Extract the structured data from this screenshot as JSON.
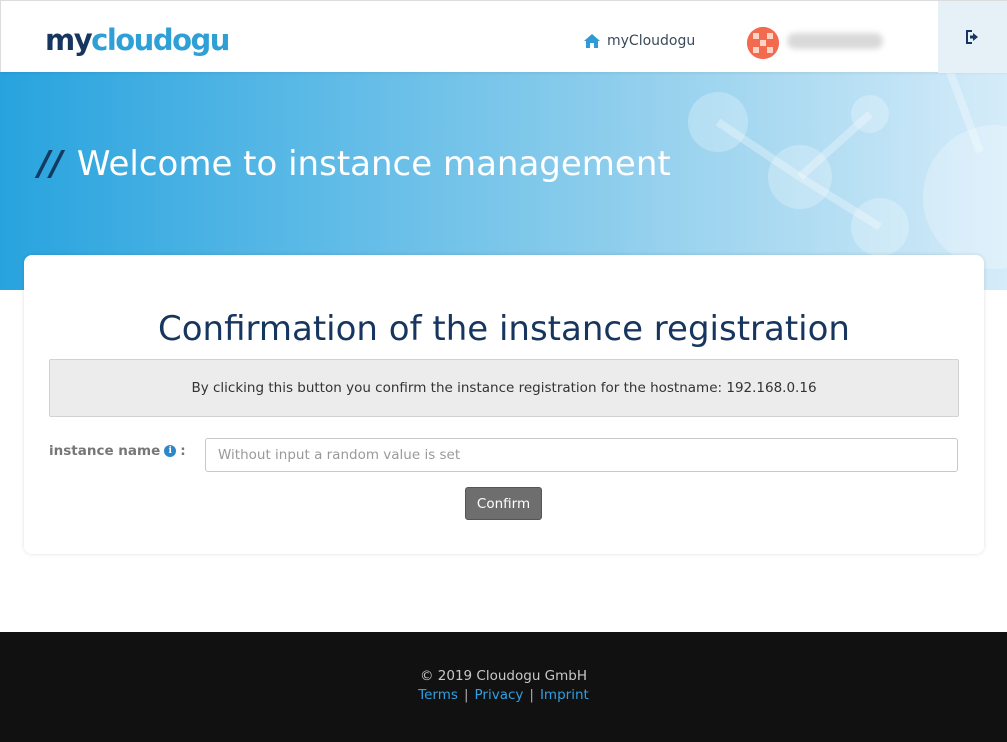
{
  "header": {
    "logo_my": "my",
    "logo_cloudogu": "cloudogu",
    "home_link": "myCloudogu",
    "icons": {
      "home": "home-icon",
      "logout": "sign-out-icon",
      "avatar": "user-avatar"
    }
  },
  "hero": {
    "slashes": "//",
    "title": "Welcome to instance management"
  },
  "card": {
    "title": "Confirmation of the instance registration",
    "info_text": "By clicking this button you confirm the instance registration for the hostname: 192.168.0.16",
    "field_label": "instance name",
    "info_icon_glyph": "i",
    "colon": ":",
    "input_placeholder": "Without input a random value is set",
    "input_value": "",
    "confirm_label": "Confirm"
  },
  "footer": {
    "copyright": "© 2019 Cloudogu GmbH",
    "links": [
      "Terms",
      "Privacy",
      "Imprint"
    ],
    "separator": "|"
  },
  "colors": {
    "brand_dark": "#16365f",
    "brand_light": "#2ea0d6",
    "hero_start": "#28a3de",
    "button": "#6e6e6e",
    "footer_bg": "#111111",
    "link": "#2fa0e0"
  }
}
